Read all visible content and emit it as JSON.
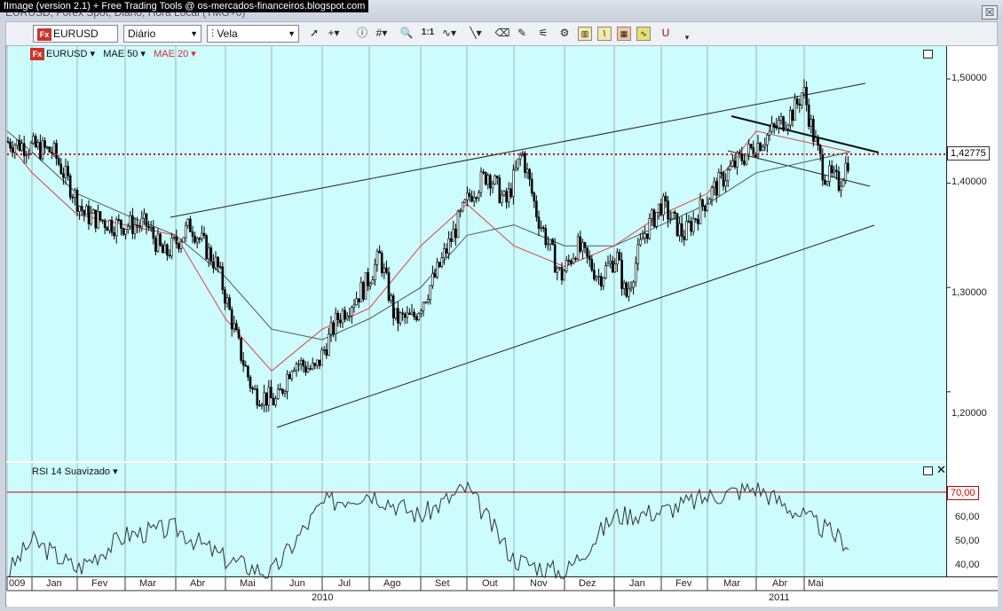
{
  "window": {
    "caption": "fImage (version 2.1) + Free Trading Tools @ os-mercados-financeiros.blogspot.com",
    "subtitle": "EURUSD, Forex Spot, Diário, Hora Local (TMG+0)",
    "close_label": "☒"
  },
  "toolbar": {
    "symbol": "EURUSD",
    "interval": "Diário",
    "chart_type": "Vela",
    "icons": [
      "pointer-icon",
      "crosshair-icon",
      "info-icon",
      "grid-icon",
      "zoom-icon",
      "ratio-icon",
      "wave-icon",
      "line-icon",
      "eraser-icon",
      "pencil-icon",
      "fibonacci-icon",
      "pattern-icon",
      "candle-icon",
      "overlay-icon",
      "indicator-icon",
      "magnet-icon"
    ],
    "ratio_label": "1:1"
  },
  "legend": {
    "symbol": "EURUSD",
    "ma50": "MAE 50",
    "ma20": "MAE 20"
  },
  "rsi_legend": "RSI 14 Suavizado",
  "price_axis": {
    "ticks": [
      "1,50000",
      "1,40000",
      "1,30000",
      "1,20000"
    ],
    "current": "1,42775"
  },
  "rsi_axis": {
    "ticks": [
      "60,00",
      "50,00",
      "40,00"
    ],
    "overbought": "70,00"
  },
  "x_axis": {
    "months": [
      "009",
      "Jan",
      "Fev",
      "Mar",
      "Abr",
      "Mai",
      "Jun",
      "Jul",
      "Ago",
      "Set",
      "Out",
      "Nov",
      "Dez",
      "Jan",
      "Fev",
      "Mar",
      "Abr",
      "Mai"
    ],
    "years": [
      "2010",
      "2011"
    ]
  },
  "colors": {
    "pane_bg": "#ccfcfd",
    "ma20": "#e0403a",
    "ma50": "#4a5a5a",
    "price_line": "#c00000",
    "up_candle": "#ffffff",
    "down_candle": "#000000"
  },
  "chart_data": [
    {
      "type": "candlestick",
      "title": "EURUSD",
      "x": [
        "2009-12",
        "2010-01",
        "2010-02",
        "2010-03",
        "2010-04",
        "2010-05",
        "2010-06",
        "2010-07",
        "2010-08",
        "2010-09",
        "2010-10",
        "2010-11",
        "2010-12",
        "2011-01",
        "2011-02",
        "2011-03",
        "2011-04",
        "2011-05"
      ],
      "close": [
        1.435,
        1.39,
        1.36,
        1.355,
        1.34,
        1.23,
        1.22,
        1.28,
        1.28,
        1.36,
        1.39,
        1.33,
        1.32,
        1.36,
        1.37,
        1.4,
        1.48,
        1.42775
      ],
      "series": [
        {
          "name": "MAE 50",
          "values": [
            1.45,
            1.43,
            1.39,
            1.37,
            1.35,
            1.31,
            1.26,
            1.25,
            1.27,
            1.3,
            1.35,
            1.36,
            1.34,
            1.34,
            1.36,
            1.38,
            1.41,
            1.43
          ]
        },
        {
          "name": "MAE 20",
          "values": [
            1.44,
            1.41,
            1.37,
            1.36,
            1.35,
            1.27,
            1.22,
            1.26,
            1.28,
            1.34,
            1.38,
            1.34,
            1.32,
            1.34,
            1.37,
            1.39,
            1.45,
            1.43
          ]
        }
      ],
      "ylim": [
        1.18,
        1.52
      ],
      "current_price": 1.42775
    },
    {
      "type": "line",
      "title": "RSI 14 Suavizado",
      "x": [
        "2009-12",
        "2010-01",
        "2010-02",
        "2010-03",
        "2010-04",
        "2010-05",
        "2010-06",
        "2010-07",
        "2010-08",
        "2010-09",
        "2010-10",
        "2010-11",
        "2010-12",
        "2011-01",
        "2011-02",
        "2011-03",
        "2011-04",
        "2011-05"
      ],
      "values": [
        36,
        50,
        38,
        52,
        55,
        42,
        36,
        65,
        70,
        60,
        72,
        42,
        36,
        60,
        62,
        68,
        72,
        48
      ],
      "ylim": [
        36,
        80
      ],
      "reference_line": 70
    }
  ]
}
